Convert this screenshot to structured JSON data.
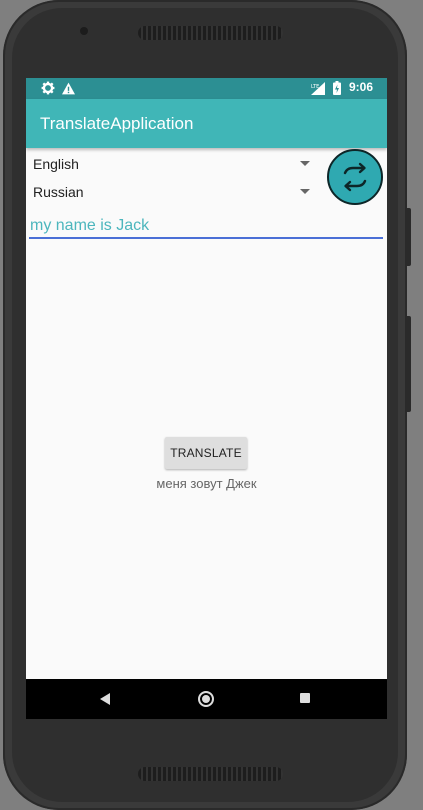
{
  "status_bar": {
    "time": "9:06",
    "icons": [
      "settings-icon",
      "warning-icon",
      "lte-signal-icon",
      "battery-icon"
    ],
    "color": "#2c8f93"
  },
  "app_bar": {
    "title": "TranslateApplication",
    "color": "#40b6b7"
  },
  "source_language": {
    "selected": "English"
  },
  "target_language": {
    "selected": "Russian"
  },
  "swap_button": {
    "icon": "swap-arrows-icon",
    "color": "#2fa9b1"
  },
  "input": {
    "value": "my name is Jack"
  },
  "translate_button": {
    "label": "TRANSLATE"
  },
  "result": {
    "text": "меня зовут Джек"
  },
  "nav_bar": {
    "icons": [
      "back-icon",
      "home-icon",
      "recents-icon"
    ]
  }
}
